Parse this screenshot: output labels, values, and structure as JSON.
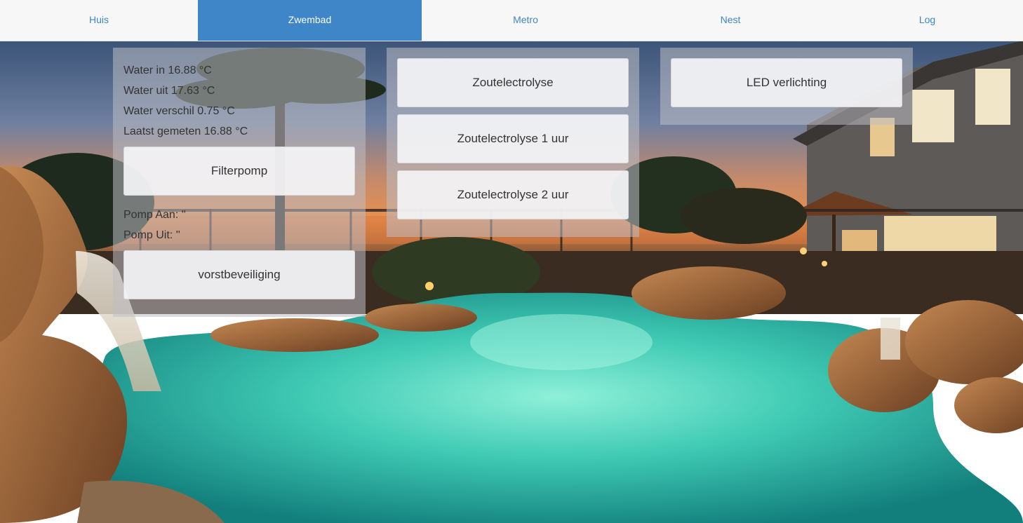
{
  "nav": {
    "items": [
      {
        "label": "Huis",
        "active": false
      },
      {
        "label": "Zwembad",
        "active": true
      },
      {
        "label": "Metro",
        "active": false
      },
      {
        "label": "Nest",
        "active": false
      },
      {
        "label": "Log",
        "active": false
      }
    ],
    "active_color": "#3f86c8",
    "link_color": "#3f86c5"
  },
  "pool_panel": {
    "water_in": "Water in 16.88 °C",
    "water_out": "Water uit 17.63 °C",
    "water_diff": "Water verschil 0.75 °C",
    "last_measured": "Laatst gemeten 16.88 °C",
    "filterpump_button": "Filterpomp",
    "pump_on": "Pomp Aan: ''",
    "pump_off": "Pomp Uit: ''",
    "frost_button": "vorstbeveiliging"
  },
  "salt_panel": {
    "buttons": [
      "Zoutelectrolyse",
      "Zoutelectrolyse 1 uur",
      "Zoutelectrolyse 2 uur"
    ]
  },
  "light_panel": {
    "led_button": "LED verlichting"
  },
  "background": {
    "image": "pool-at-sunset-photo"
  }
}
